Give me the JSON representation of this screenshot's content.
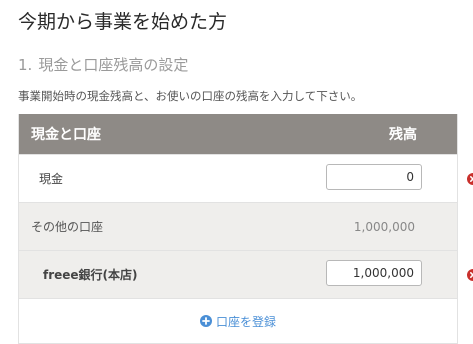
{
  "page": {
    "title": "今期から事業を始めた方"
  },
  "section": {
    "number": "1.",
    "heading": "現金と口座残高の設定",
    "description": "事業開始時の現金残高と、お使いの口座の残高を入力して下さい。"
  },
  "table": {
    "headers": {
      "left": "現金と口座",
      "right": "残高"
    },
    "cash": {
      "label": "現金",
      "value": "0"
    },
    "other_accounts": {
      "label": "その他の口座",
      "total": "1,000,000"
    },
    "bank_account": {
      "label": "freee銀行(本店)",
      "value": "1,000,000"
    },
    "register_label": "口座を登録"
  },
  "colors": {
    "header_bg": "#8e8a86",
    "row_gray": "#efeeec",
    "remove_red": "#c9302c",
    "link_blue": "#4a8fd6"
  }
}
